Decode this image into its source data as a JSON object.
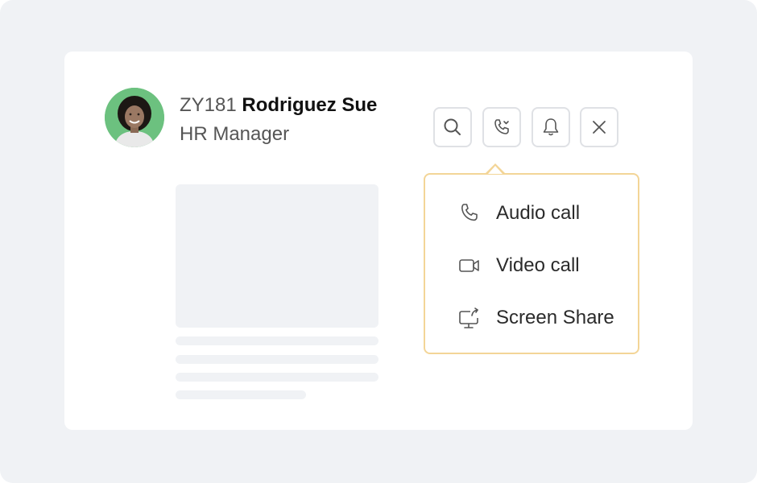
{
  "profile": {
    "employee_id": "ZY181",
    "name": "Rodriguez Sue",
    "role": "HR Manager",
    "avatar_bg": "#6cc17f"
  },
  "toolbar": {
    "buttons": [
      {
        "icon": "search-icon"
      },
      {
        "icon": "call-options-icon"
      },
      {
        "icon": "bell-icon"
      },
      {
        "icon": "close-icon"
      }
    ]
  },
  "call_menu": {
    "border_color": "#f3d597",
    "items": [
      {
        "label": "Audio call",
        "icon": "phone-icon"
      },
      {
        "label": "Video call",
        "icon": "video-camera-icon"
      },
      {
        "label": "Screen Share",
        "icon": "screen-share-icon"
      }
    ]
  }
}
